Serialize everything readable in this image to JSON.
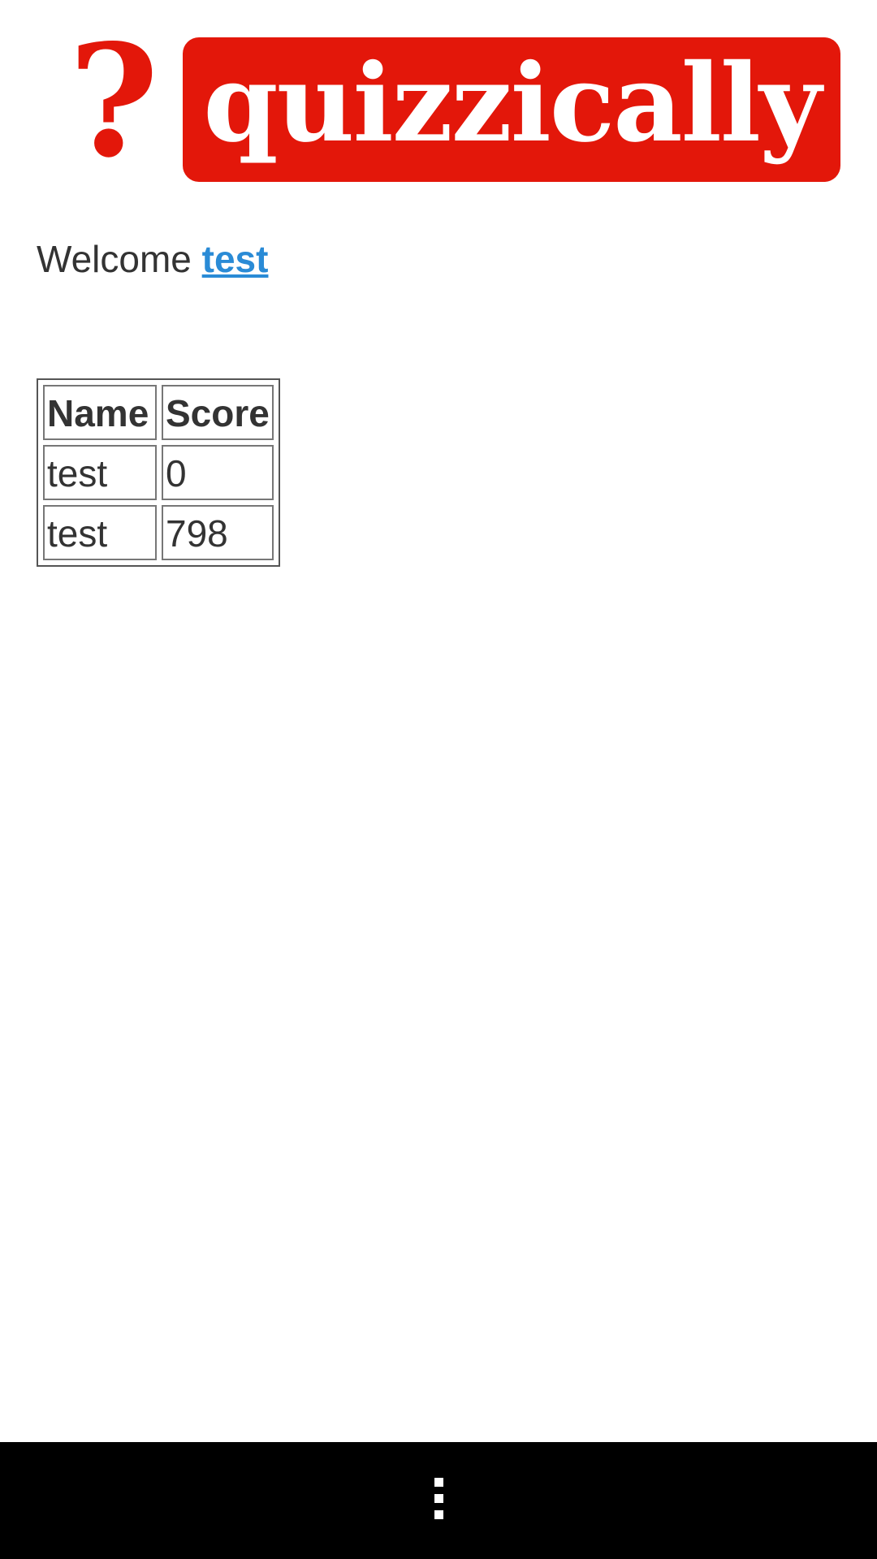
{
  "header": {
    "logo_mark": "?",
    "logo_text": "quizzically",
    "brand_color": "#e3170a"
  },
  "welcome": {
    "prefix": "Welcome",
    "username": "test",
    "link_color": "#2a8bd6"
  },
  "scores_table": {
    "headers": [
      "Name",
      "Score"
    ],
    "rows": [
      {
        "name": "test",
        "score": "0"
      },
      {
        "name": "test",
        "score": "798"
      }
    ]
  },
  "navbar": {
    "menu_icon": "overflow-menu-icon"
  }
}
